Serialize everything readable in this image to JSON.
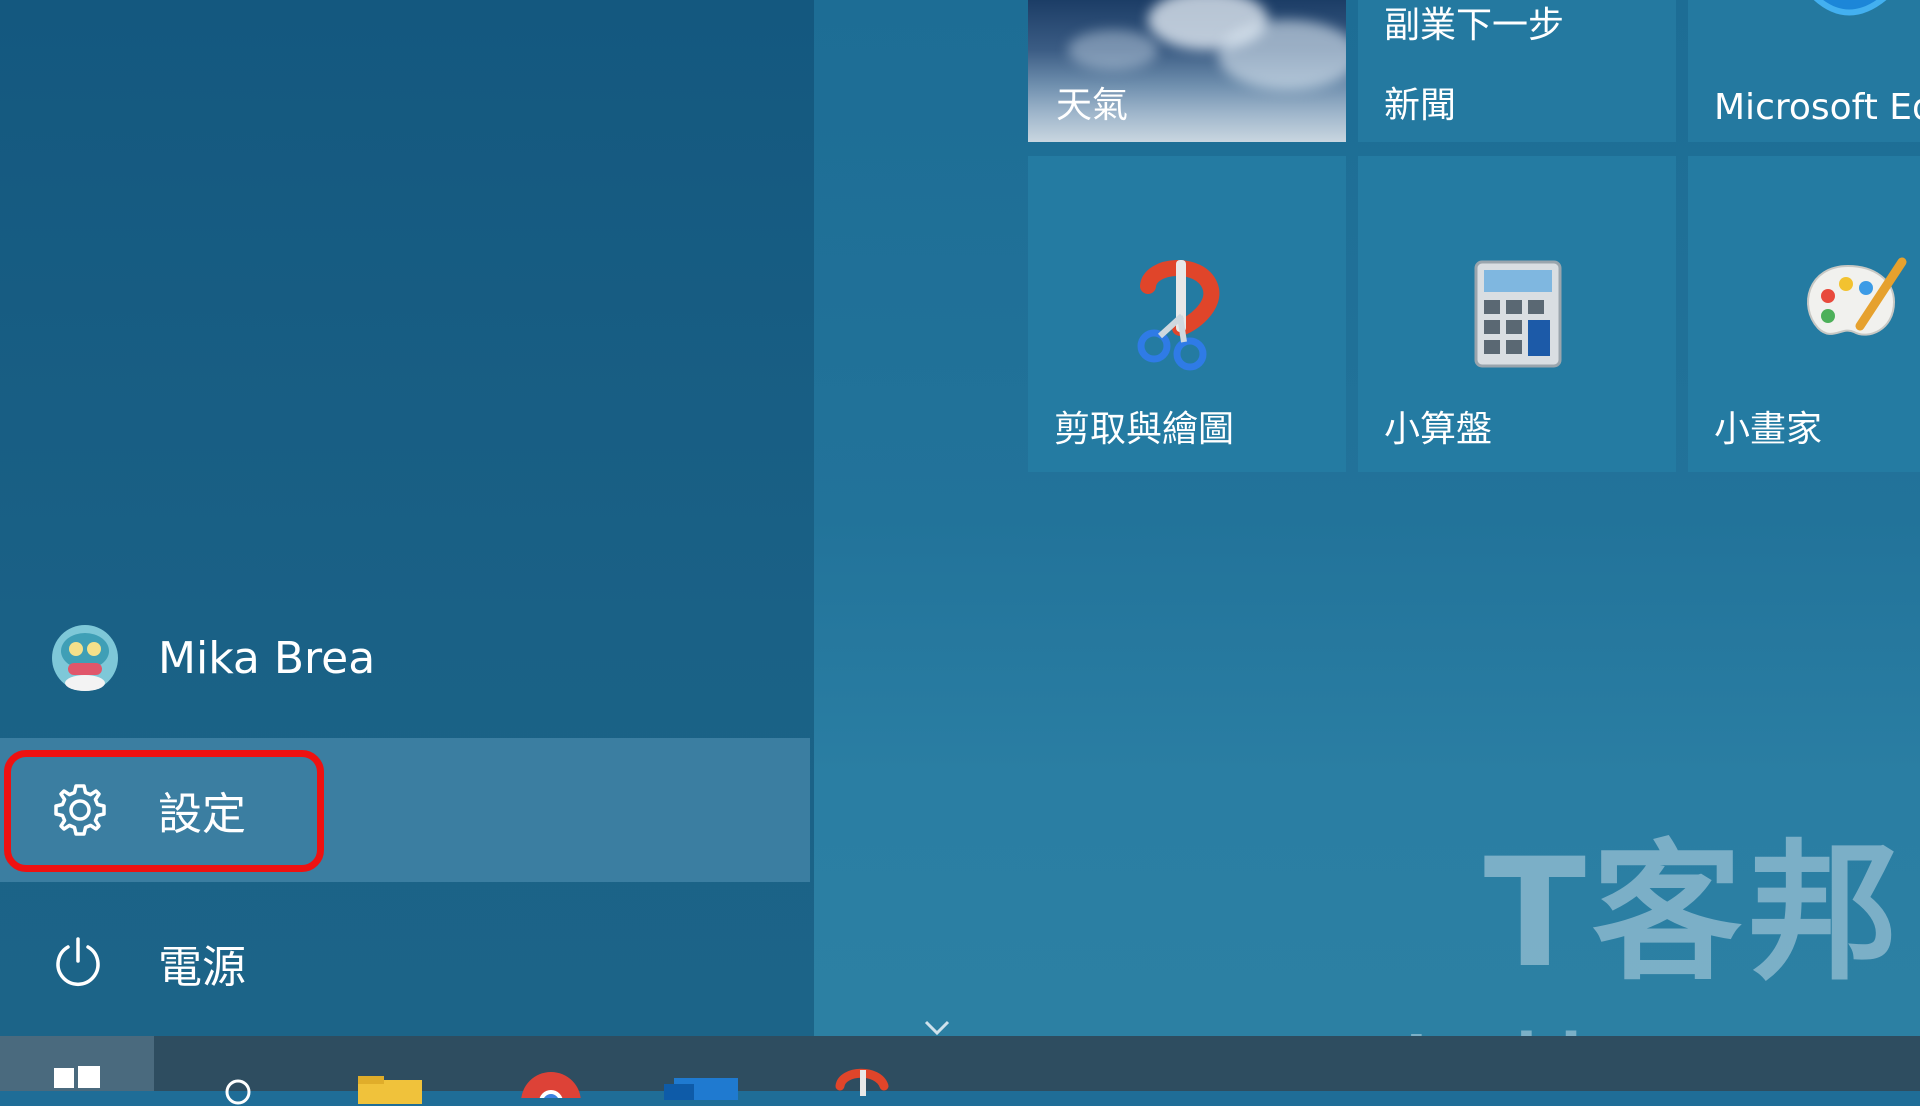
{
  "start_menu": {
    "user": {
      "name": "Mika Brea"
    },
    "settings": {
      "label": "設定"
    },
    "power": {
      "label": "電源"
    }
  },
  "tiles": {
    "weather": {
      "label": "天氣"
    },
    "news": {
      "label": "新聞",
      "headline": "副業下一步"
    },
    "edge": {
      "label": "Microsoft Ed"
    },
    "snip": {
      "label": "剪取與繪圖"
    },
    "calculator": {
      "label": "小算盤"
    },
    "paint": {
      "label": "小畫家"
    }
  },
  "watermark": {
    "chinese": "T客邦",
    "site": "techbang.com"
  },
  "colors": {
    "highlight": "#ee1111",
    "settings_hover": "#3b7ea1"
  },
  "icons": {
    "settings": "gear-icon",
    "power": "power-icon",
    "scroll": "chevron-down-icon",
    "start": "windows-logo-icon",
    "search": "search-icon"
  }
}
